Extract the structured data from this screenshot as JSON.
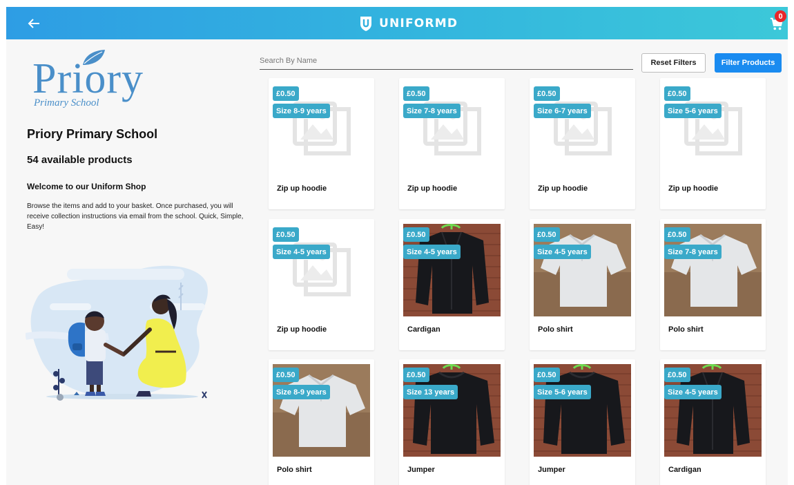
{
  "header": {
    "brand": "UNIFORMD",
    "cart_count": "0"
  },
  "logo": {
    "word": "Priory",
    "subtitle": "Primary School"
  },
  "school": {
    "name": "Priory Primary School",
    "product_count": "54 available products",
    "welcome_title": "Welcome to our Uniform Shop",
    "welcome_text": "Browse the items and add to your basket. Once purchased, you will receive collection instructions via email from the school. Quick, Simple, Easy!"
  },
  "search": {
    "placeholder": "Search By Name",
    "value": ""
  },
  "filters": {
    "reset_label": "Reset Filters",
    "filter_label": "Filter Products"
  },
  "products": [
    {
      "price": "£0.50",
      "size": "Size 8-9 years",
      "name": "Zip up hoodie",
      "image": "placeholder"
    },
    {
      "price": "£0.50",
      "size": "Size 7-8 years",
      "name": "Zip up hoodie",
      "image": "placeholder"
    },
    {
      "price": "£0.50",
      "size": "Size 6-7 years",
      "name": "Zip up hoodie",
      "image": "placeholder"
    },
    {
      "price": "£0.50",
      "size": "Size 5-6 years",
      "name": "Zip up hoodie",
      "image": "placeholder"
    },
    {
      "price": "£0.50",
      "size": "Size 4-5 years",
      "name": "Zip up hoodie",
      "image": "placeholder"
    },
    {
      "price": "£0.50",
      "size": "Size 4-5 years",
      "name": "Cardigan",
      "image": "cardigan-photo"
    },
    {
      "price": "£0.50",
      "size": "Size 4-5 years",
      "name": "Polo shirt",
      "image": "polo-photo"
    },
    {
      "price": "£0.50",
      "size": "Size 7-8 years",
      "name": "Polo shirt",
      "image": "polo-photo"
    },
    {
      "price": "£0.50",
      "size": "Size 8-9 years",
      "name": "Polo shirt",
      "image": "polo-photo"
    },
    {
      "price": "£0.50",
      "size": "Size 13 years",
      "name": "Jumper",
      "image": "jumper-photo"
    },
    {
      "price": "£0.50",
      "size": "Size 5-6 years",
      "name": "Jumper",
      "image": "jumper-photo"
    },
    {
      "price": "£0.50",
      "size": "Size 4-5 years",
      "name": "Cardigan",
      "image": "cardigan-photo"
    }
  ],
  "colors": {
    "header_start": "#2e9de4",
    "header_end": "#3cc8d9",
    "badge": "#3aa9c9",
    "filter_button": "#1a8bf0",
    "cart_badge": "#e8262a"
  }
}
